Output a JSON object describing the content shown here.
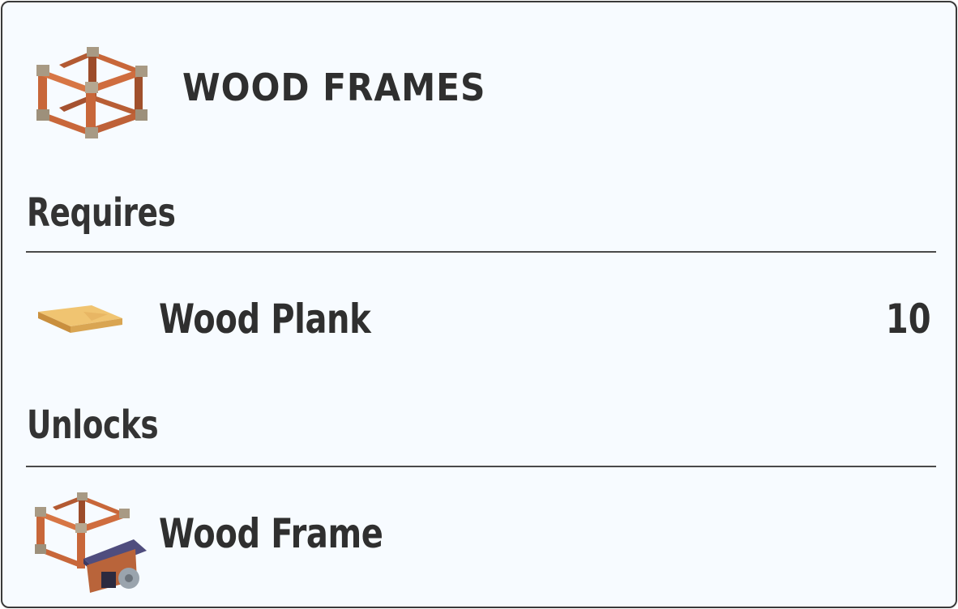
{
  "item": {
    "title": "WOOD FRAMES",
    "icon": "wood-frames-icon"
  },
  "requires": {
    "heading": "Requires",
    "items": [
      {
        "label": "Wood Plank",
        "quantity": "10",
        "icon": "wood-plank-icon"
      }
    ]
  },
  "unlocks": {
    "heading": "Unlocks",
    "items": [
      {
        "label": "Wood Frame",
        "icon": "wood-frame-building-icon"
      }
    ]
  },
  "colors": {
    "card_background": "#f7fbff",
    "border": "#3a3a3a",
    "text": "#2f2f2f",
    "wood": "#c8673a",
    "wood_dark": "#8c4326",
    "joint": "#a89a84",
    "plank": "#e6b55d",
    "roof": "#5b5a8a"
  }
}
